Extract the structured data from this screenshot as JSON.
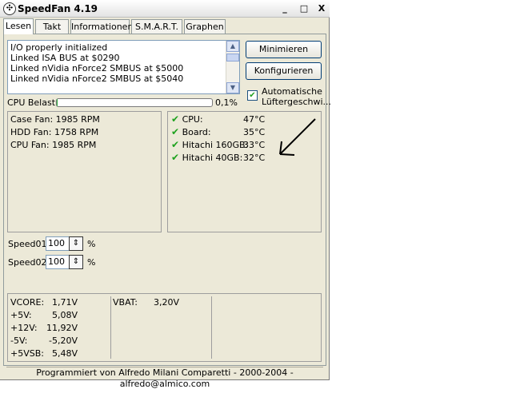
{
  "window": {
    "title": "SpeedFan 4.19",
    "minimize": "_",
    "maximize": "□",
    "close": "X"
  },
  "tabs": [
    "Lesen",
    "Takt",
    "Informationen",
    "S.M.A.R.T.",
    "Graphen"
  ],
  "log": [
    "I/O properly initialized",
    "Linked ISA BUS at $0290",
    "Linked nVidia nForce2 SMBUS at $5000",
    "Linked nVidia nForce2 SMBUS at $5040"
  ],
  "buttons": {
    "minimize": "Minimieren",
    "configure": "Konfigurieren"
  },
  "auto": {
    "checked": true,
    "line1": "Automatische",
    "line2": "Lüftergeschwi..."
  },
  "cpu": {
    "label": "CPU Belastung",
    "value": "0,1%",
    "usage_fraction": 0.001
  },
  "fans": [
    "Case Fan: 1985 RPM",
    "HDD Fan: 1758 RPM",
    "CPU Fan: 1985 RPM"
  ],
  "temps": [
    {
      "name": "CPU:",
      "value": "47°C"
    },
    {
      "name": "Board:",
      "value": "35°C"
    },
    {
      "name": "Hitachi 160GB:",
      "value": "33°C"
    },
    {
      "name": "Hitachi 40GB:",
      "value": "32°C"
    }
  ],
  "speeds": [
    {
      "label": "Speed01:",
      "value": "100",
      "unit": "%"
    },
    {
      "label": "Speed02:",
      "value": "100",
      "unit": "%"
    }
  ],
  "voltages": [
    {
      "name": "VCORE:",
      "value": "1,71V"
    },
    {
      "name": "+5V:",
      "value": "5,08V"
    },
    {
      "name": "+12V:",
      "value": "11,92V"
    },
    {
      "name": "-5V:",
      "value": "-5,20V"
    },
    {
      "name": "+5VSB:",
      "value": "5,48V"
    }
  ],
  "vbat": {
    "name": "VBAT:",
    "value": "3,20V"
  },
  "status": "Programmiert von Alfredo Milani Comparetti - 2000-2004 - alfredo@almico.com"
}
